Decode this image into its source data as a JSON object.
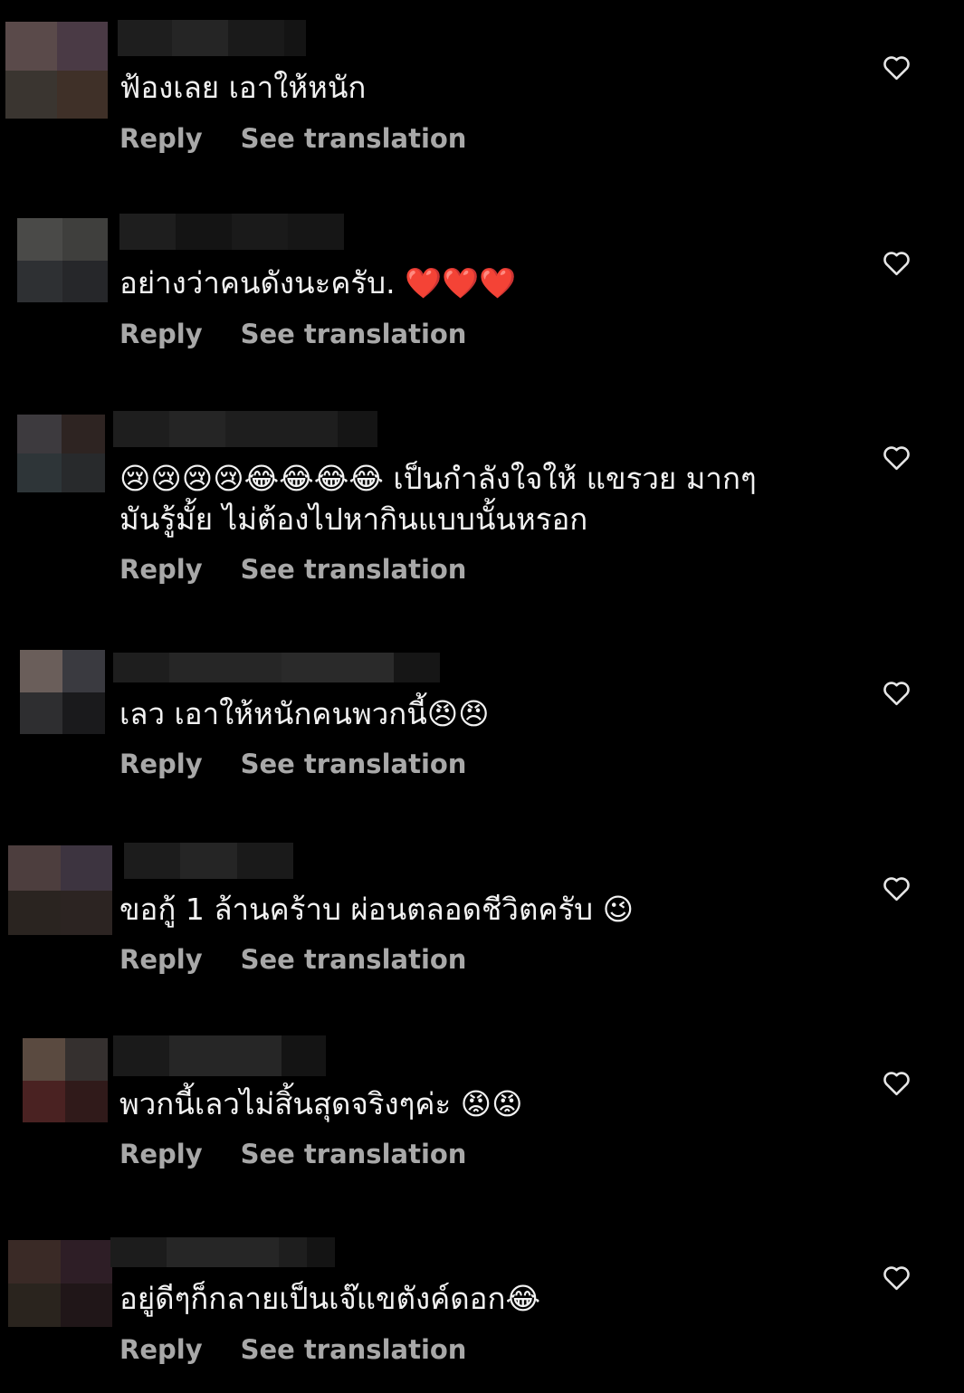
{
  "comments": [
    {
      "text": "ฟ้องเลย เอาให้หนัก",
      "reply_label": "Reply",
      "translate_label": "See translation",
      "avatar_colors": [
        "#5a4a4a",
        "#4a3a45",
        "#3a3530",
        "#3f3028"
      ],
      "username_colors": [
        "#1e1e1e",
        "#252525",
        "#1a1a1a",
        "#141414"
      ]
    },
    {
      "text": "อย่างว่าคนดังนะครับ. ❤️❤️❤️",
      "reply_label": "Reply",
      "translate_label": "See translation",
      "avatar_colors": [
        "#4a4a48",
        "#3f3f3d",
        "#2e3033",
        "#26272a"
      ],
      "username_colors": [
        "#1e1e1e",
        "#141414",
        "#1a1a1a",
        "#161616"
      ]
    },
    {
      "text": "😢😢😢😢😂😂😂😂 เป็นกำลังใจให้ แขรวย มากๆมันรู้มั้ย ไม่ต้องไปหากินแบบนั้นหรอก",
      "reply_label": "Reply",
      "translate_label": "See translation",
      "avatar_colors": [
        "#3d3a3e",
        "#2e2422",
        "#2e3538",
        "#282a2c"
      ],
      "username_colors": [
        "#1e1e1e",
        "#252525",
        "#1e1e1e",
        "#151515"
      ]
    },
    {
      "text": "เลว เอาให้หนักคนพวกนี้😠😠",
      "reply_label": "Reply",
      "translate_label": "See translation",
      "avatar_colors": [
        "#6a5e5a",
        "#3a3a40",
        "#2e2e30",
        "#1a1a1c"
      ],
      "username_colors": [
        "#1e1e1e",
        "#262626",
        "#2a2a2a",
        "#161616"
      ]
    },
    {
      "text": "ขอกู้ 1 ล้านคร้าบ ผ่อนตลอดชีวิตครับ 😉",
      "reply_label": "Reply",
      "translate_label": "See translation",
      "avatar_colors": [
        "#4d3e3e",
        "#3d3440",
        "#2a2420",
        "#2c2422"
      ],
      "username_colors": [
        "#1c1c1c",
        "#252525",
        "#1a1a1a",
        "#1a1a1a"
      ]
    },
    {
      "text": "พวกนี้เลวไม่สิ้นสุดจริงๆค่ะ 😡😡",
      "reply_label": "Reply",
      "translate_label": "See translation",
      "avatar_colors": [
        "#5a4a40",
        "#35302f",
        "#4a2222",
        "#301a1a"
      ],
      "username_colors": [
        "#1a1a1a",
        "#262626",
        "#141414",
        "#141414"
      ]
    },
    {
      "text": "อยู่ดีๆก็กลายเป็นเจ๊แขตังค์ดอก😂",
      "reply_label": "Reply",
      "translate_label": "See translation",
      "avatar_colors": [
        "#3a2a26",
        "#2e1e26",
        "#2a241e",
        "#201618"
      ],
      "username_colors": [
        "#1c1c1c",
        "#262626",
        "#1e1e1e",
        "#141414"
      ]
    }
  ]
}
